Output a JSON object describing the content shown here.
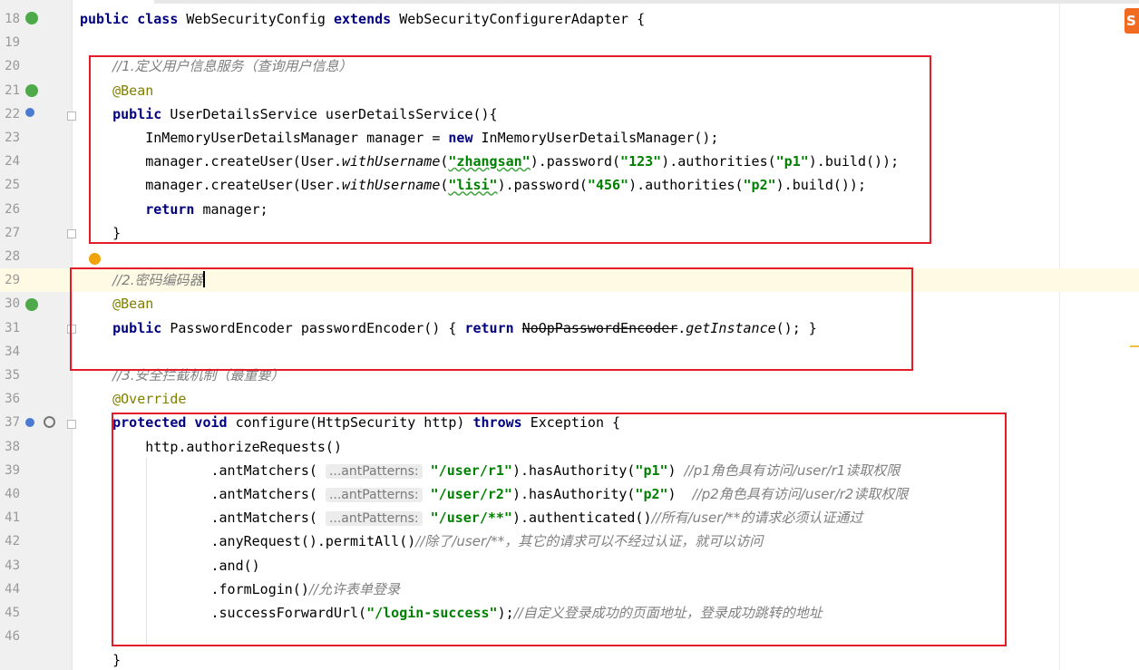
{
  "editor": {
    "lines": [
      {
        "num": "18",
        "tokens": [
          {
            "t": "public class ",
            "c": "kw"
          },
          {
            "t": "WebSecurityConfig "
          },
          {
            "t": "extends ",
            "c": "kw"
          },
          {
            "t": "WebSecurityConfigurerAdapter {"
          }
        ]
      },
      {
        "num": "19",
        "tokens": []
      },
      {
        "num": "20",
        "tokens": [
          {
            "t": "    "
          },
          {
            "t": "//1.定义用户信息服务（查询用户信息）",
            "c": "cm"
          }
        ]
      },
      {
        "num": "21",
        "tokens": [
          {
            "t": "    "
          },
          {
            "t": "@Bean",
            "c": "an"
          }
        ]
      },
      {
        "num": "22",
        "tokens": [
          {
            "t": "    "
          },
          {
            "t": "public ",
            "c": "kw"
          },
          {
            "t": "UserDetailsService userDetailsService(){"
          }
        ]
      },
      {
        "num": "23",
        "tokens": [
          {
            "t": "        InMemoryUserDetailsManager manager = "
          },
          {
            "t": "new ",
            "c": "kw"
          },
          {
            "t": "InMemoryUserDetailsManager();"
          }
        ]
      },
      {
        "num": "24",
        "tokens": [
          {
            "t": "        manager.createUser(User."
          },
          {
            "t": "withUsername",
            "c": "it"
          },
          {
            "t": "("
          },
          {
            "t": "\"zhangsan\"",
            "c": "st wavy"
          },
          {
            "t": ").password("
          },
          {
            "t": "\"123\"",
            "c": "st"
          },
          {
            "t": ").authorities("
          },
          {
            "t": "\"p1\"",
            "c": "st"
          },
          {
            "t": ").build());"
          }
        ]
      },
      {
        "num": "25",
        "tokens": [
          {
            "t": "        manager.createUser(User."
          },
          {
            "t": "withUsername",
            "c": "it"
          },
          {
            "t": "("
          },
          {
            "t": "\"lisi\"",
            "c": "st wavy"
          },
          {
            "t": ").password("
          },
          {
            "t": "\"456\"",
            "c": "st"
          },
          {
            "t": ").authorities("
          },
          {
            "t": "\"p2\"",
            "c": "st"
          },
          {
            "t": ").build());"
          }
        ]
      },
      {
        "num": "26",
        "tokens": [
          {
            "t": "        "
          },
          {
            "t": "return ",
            "c": "kw"
          },
          {
            "t": "manager;"
          }
        ]
      },
      {
        "num": "27",
        "tokens": [
          {
            "t": "    }"
          }
        ]
      },
      {
        "num": "28",
        "tokens": []
      },
      {
        "num": "29",
        "tokens": [
          {
            "t": "    "
          },
          {
            "t": "//2.密码编码器",
            "c": "cm"
          },
          {
            "t": "",
            "c": "cursor"
          }
        ]
      },
      {
        "num": "30",
        "tokens": [
          {
            "t": "    "
          },
          {
            "t": "@Bean",
            "c": "an"
          }
        ]
      },
      {
        "num": "31",
        "tokens": [
          {
            "t": "    "
          },
          {
            "t": "public ",
            "c": "kw"
          },
          {
            "t": "PasswordEncoder passwordEncoder() { "
          },
          {
            "t": "return ",
            "c": "kw"
          },
          {
            "t": "NoOpPasswordEncoder",
            "c": "strike"
          },
          {
            "t": "."
          },
          {
            "t": "getInstance",
            "c": "it"
          },
          {
            "t": "(); }"
          }
        ]
      },
      {
        "num": "34",
        "tokens": []
      },
      {
        "num": "35",
        "tokens": [
          {
            "t": "    "
          },
          {
            "t": "//3.安全拦截机制（最重要）",
            "c": "cm"
          }
        ]
      },
      {
        "num": "36",
        "tokens": [
          {
            "t": "    "
          },
          {
            "t": "@Override",
            "c": "an"
          }
        ]
      },
      {
        "num": "37",
        "tokens": [
          {
            "t": "    "
          },
          {
            "t": "protected void ",
            "c": "kw"
          },
          {
            "t": "configure(HttpSecurity http) "
          },
          {
            "t": "throws ",
            "c": "kw"
          },
          {
            "t": "Exception {"
          }
        ]
      },
      {
        "num": "38",
        "tokens": [
          {
            "t": "        http.authorizeRequests()"
          }
        ]
      },
      {
        "num": "39",
        "tokens": [
          {
            "t": "                .antMatchers( "
          },
          {
            "t": "...antPatterns:",
            "c": "hint"
          },
          {
            "t": " "
          },
          {
            "t": "\"/user/r1\"",
            "c": "st"
          },
          {
            "t": ").hasAuthority("
          },
          {
            "t": "\"p1\"",
            "c": "st"
          },
          {
            "t": ") "
          },
          {
            "t": "//p1角色具有访问/user/r1读取权限",
            "c": "cm"
          }
        ]
      },
      {
        "num": "40",
        "tokens": [
          {
            "t": "                .antMatchers( "
          },
          {
            "t": "...antPatterns:",
            "c": "hint"
          },
          {
            "t": " "
          },
          {
            "t": "\"/user/r2\"",
            "c": "st"
          },
          {
            "t": ").hasAuthority("
          },
          {
            "t": "\"p2\"",
            "c": "st"
          },
          {
            "t": ")  "
          },
          {
            "t": "//p2角色具有访问/user/r2读取权限",
            "c": "cm"
          }
        ]
      },
      {
        "num": "41",
        "tokens": [
          {
            "t": "                .antMatchers( "
          },
          {
            "t": "...antPatterns:",
            "c": "hint"
          },
          {
            "t": " "
          },
          {
            "t": "\"/user/**\"",
            "c": "st"
          },
          {
            "t": ").authenticated()"
          },
          {
            "t": "//所有/user/**的请求必须认证通过",
            "c": "cm"
          }
        ]
      },
      {
        "num": "42",
        "tokens": [
          {
            "t": "                .anyRequest().permitAll()"
          },
          {
            "t": "//除了/user/**，其它的请求可以不经过认证，就可以访问",
            "c": "cm"
          }
        ]
      },
      {
        "num": "43",
        "tokens": [
          {
            "t": "                .and()"
          }
        ]
      },
      {
        "num": "44",
        "tokens": [
          {
            "t": "                .formLogin()"
          },
          {
            "t": "//允许表单登录",
            "c": "cm"
          }
        ]
      },
      {
        "num": "45",
        "tokens": [
          {
            "t": "                .successForwardUrl("
          },
          {
            "t": "\"/login-success\"",
            "c": "st"
          },
          {
            "t": ");"
          },
          {
            "t": "//自定义登录成功的页面地址，登录成功跳转的地址",
            "c": "cm"
          }
        ]
      },
      {
        "num": "46",
        "tokens": []
      },
      {
        "num": "",
        "tokens": [
          {
            "t": "    }"
          }
        ]
      }
    ]
  },
  "logo_text": "S",
  "colors": {
    "highlight_box": "#e41c2a",
    "keyword": "#000080",
    "string": "#008000",
    "comment": "#808080",
    "annotation": "#808000"
  }
}
